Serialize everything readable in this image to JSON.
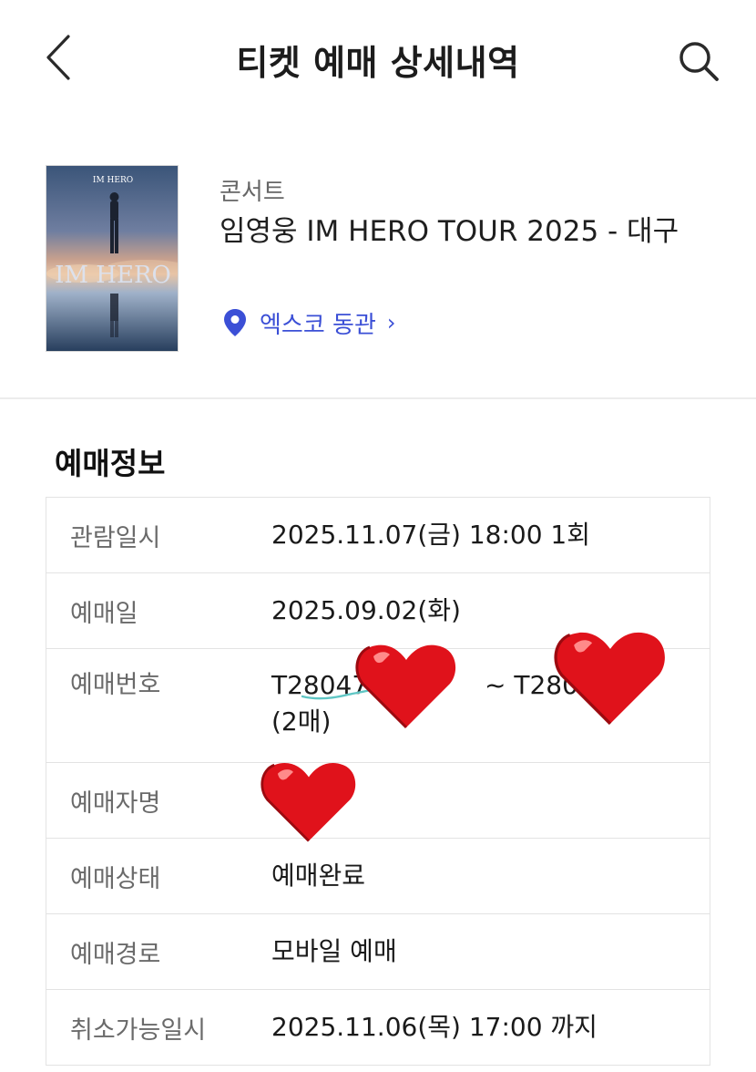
{
  "header": {
    "title": "티켓 예매 상세내역",
    "back_icon": "chevron-left-icon",
    "search_icon": "search-icon"
  },
  "event": {
    "category": "콘서트",
    "title": "임영웅 IM HERO TOUR 2025 - 대구",
    "poster_text": "IM HERO",
    "poster_small_text": "IM HERO",
    "venue": "엑스코 동관",
    "venue_chevron": "›",
    "venue_icon": "location-pin-icon"
  },
  "booking_info": {
    "section_title": "예매정보",
    "rows": [
      {
        "label": "관람일시",
        "value": "2025.11.07(금) 18:00 1회"
      },
      {
        "label": "예매일",
        "value": "2025.09.02(화)"
      },
      {
        "label": "예매번호",
        "value": "T28047",
        "value_mid": "~ T28047",
        "value_line2": "(2매)"
      },
      {
        "label": "예매자명",
        "value": ""
      },
      {
        "label": "예매상태",
        "value": "예매완료"
      },
      {
        "label": "예매경로",
        "value": "모바일 예매"
      },
      {
        "label": "취소가능일시",
        "value": "2025.11.06(목) 17:00 까지"
      }
    ]
  },
  "colors": {
    "accent": "#3b4fd6",
    "heart_sticker": "#e0121b",
    "divider": "#ececec"
  }
}
